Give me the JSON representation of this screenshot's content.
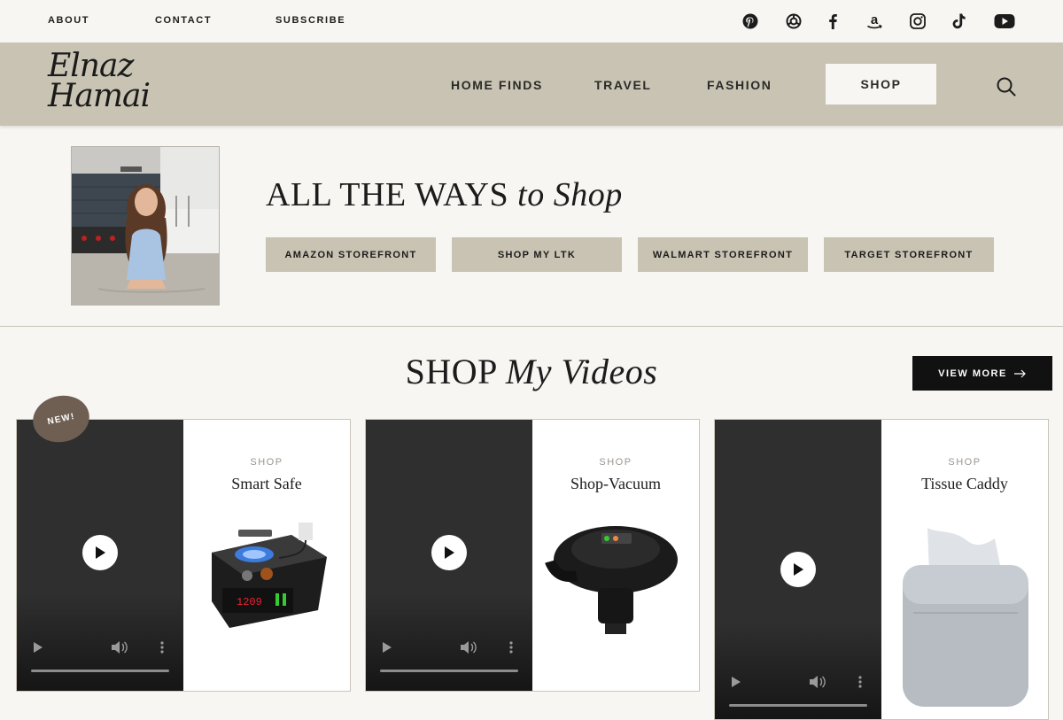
{
  "topbar": {
    "links": [
      "ABOUT",
      "CONTACT",
      "SUBSCRIBE"
    ],
    "social_icons": [
      "pinterest-icon",
      "ltk-icon",
      "facebook-icon",
      "amazon-icon",
      "instagram-icon",
      "tiktok-icon",
      "youtube-icon"
    ]
  },
  "nav": {
    "logo_line1": "Elnaz",
    "logo_line2": "Hamai",
    "items": [
      "HOME FINDS",
      "TRAVEL",
      "FASHION"
    ],
    "shop_label": "SHOP"
  },
  "ways": {
    "title_main": "ALL THE WAYS ",
    "title_italic": "to Shop",
    "stores": [
      "AMAZON STOREFRONT",
      "SHOP MY LTK",
      "WALMART STOREFRONT",
      "TARGET STOREFRONT"
    ]
  },
  "videos": {
    "title_main": "SHOP ",
    "title_italic": "My Videos",
    "view_more": "VIEW MORE",
    "new_badge": "NEW!",
    "cards": [
      {
        "shop_label": "SHOP",
        "name": "Smart Safe"
      },
      {
        "shop_label": "SHOP",
        "name": "Shop-Vacuum"
      },
      {
        "shop_label": "SHOP",
        "name": "Tissue Caddy"
      }
    ]
  },
  "colors": {
    "background": "#f7f6f2",
    "nav_bg": "#c8c3b2",
    "button_bg": "#c8c3b2",
    "dark_button": "#111111",
    "badge": "#6e5f52"
  }
}
